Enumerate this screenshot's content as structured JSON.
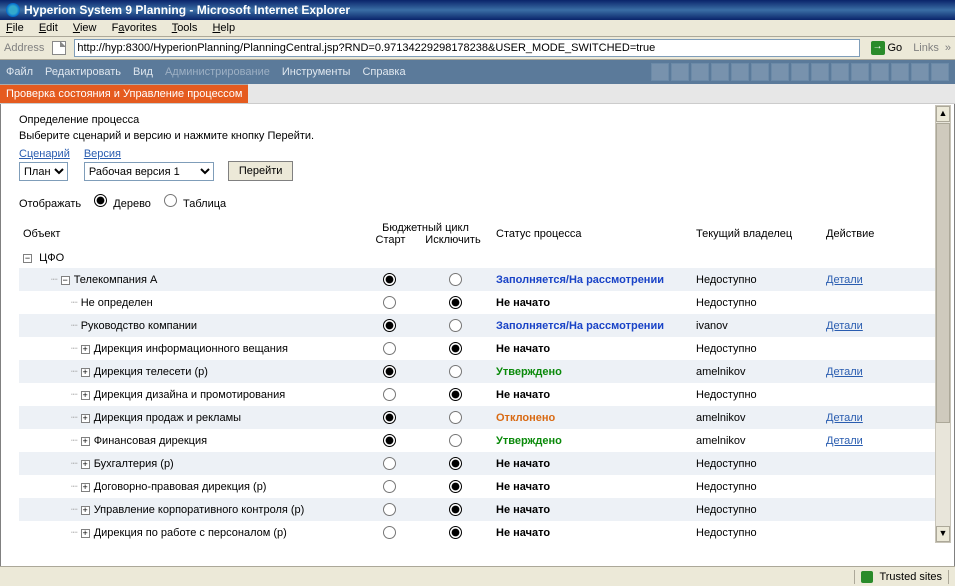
{
  "window": {
    "title": "Hyperion System 9 Planning - Microsoft Internet Explorer"
  },
  "ie_menu": [
    "File",
    "Edit",
    "View",
    "Favorites",
    "Tools",
    "Help"
  ],
  "address": {
    "label": "Address",
    "url": "http://hyp:8300/HyperionPlanning/PlanningCentral.jsp?RND=0.97134229298178238&USER_MODE_SWITCHED=true",
    "go": "Go",
    "links": "Links"
  },
  "app_menu": {
    "items": [
      {
        "label": "Файл",
        "disabled": false
      },
      {
        "label": "Редактировать",
        "disabled": false
      },
      {
        "label": "Вид",
        "disabled": false
      },
      {
        "label": "Администрирование",
        "disabled": true
      },
      {
        "label": "Инструменты",
        "disabled": false
      },
      {
        "label": "Справка",
        "disabled": false
      }
    ]
  },
  "subheader": "Проверка состояния и Управление процессом",
  "proc": {
    "title": "Определение процесса",
    "instr": "Выберите сценарий и версию и нажмите кнопку Перейти.",
    "scenario_lbl": "Сценарий",
    "version_lbl": "Версия",
    "scenario_sel": "План",
    "version_sel": "Рабочая версия 1",
    "go_btn": "Перейти",
    "view_lbl": "Отображать",
    "view_tree": "Дерево",
    "view_table": "Таблица"
  },
  "headers": {
    "object": "Объект",
    "cycle": "Бюджетный цикл",
    "start": "Старт",
    "exclude": "Исключить",
    "status": "Статус процесса",
    "owner": "Текущий владелец",
    "action": "Действие"
  },
  "root": {
    "label": "ЦФО"
  },
  "rows": [
    {
      "indent": 1,
      "expand": "-",
      "label": "Телекомпания A",
      "radio": "start",
      "status": "Заполняется/На рассмотрении",
      "st_cls": "st-blue",
      "owner": "Недоступно",
      "action": "Детали"
    },
    {
      "indent": 2,
      "expand": "",
      "label": "Не определен",
      "radio": "exclude",
      "status": "Не начато",
      "st_cls": "st-black",
      "owner": "Недоступно",
      "action": ""
    },
    {
      "indent": 2,
      "expand": "",
      "label": "Руководство компании",
      "radio": "start",
      "status": "Заполняется/На рассмотрении",
      "st_cls": "st-blue",
      "owner": "ivanov",
      "action": "Детали"
    },
    {
      "indent": 2,
      "expand": "+",
      "label": "Дирекция информационного вещания",
      "radio": "exclude",
      "status": "Не начато",
      "st_cls": "st-black",
      "owner": "Недоступно",
      "action": ""
    },
    {
      "indent": 2,
      "expand": "+",
      "label": "Дирекция телесети (р)",
      "radio": "start",
      "status": "Утверждено",
      "st_cls": "st-green",
      "owner": "amelnikov",
      "action": "Детали"
    },
    {
      "indent": 2,
      "expand": "+",
      "label": "Дирекция дизайна и промотирования",
      "radio": "exclude",
      "status": "Не начато",
      "st_cls": "st-black",
      "owner": "Недоступно",
      "action": ""
    },
    {
      "indent": 2,
      "expand": "+",
      "label": "Дирекция продаж и рекламы",
      "radio": "start",
      "status": "Отклонено",
      "st_cls": "st-orange",
      "owner": "amelnikov",
      "action": "Детали"
    },
    {
      "indent": 2,
      "expand": "+",
      "label": "Финансовая дирекция",
      "radio": "start",
      "status": "Утверждено",
      "st_cls": "st-green",
      "owner": "amelnikov",
      "action": "Детали"
    },
    {
      "indent": 2,
      "expand": "+",
      "label": "Бухгалтерия (р)",
      "radio": "exclude",
      "status": "Не начато",
      "st_cls": "st-black",
      "owner": "Недоступно",
      "action": ""
    },
    {
      "indent": 2,
      "expand": "+",
      "label": "Договорно-правовая дирекция (р)",
      "radio": "exclude",
      "status": "Не начато",
      "st_cls": "st-black",
      "owner": "Недоступно",
      "action": ""
    },
    {
      "indent": 2,
      "expand": "+",
      "label": "Управление корпоративного контроля (р)",
      "radio": "exclude",
      "status": "Не начато",
      "st_cls": "st-black",
      "owner": "Недоступно",
      "action": ""
    },
    {
      "indent": 2,
      "expand": "+",
      "label": "Дирекция по работе с персоналом (р)",
      "radio": "exclude",
      "status": "Не начато",
      "st_cls": "st-black",
      "owner": "Недоступно",
      "action": ""
    }
  ],
  "statusbar": {
    "trusted": "Trusted sites"
  }
}
